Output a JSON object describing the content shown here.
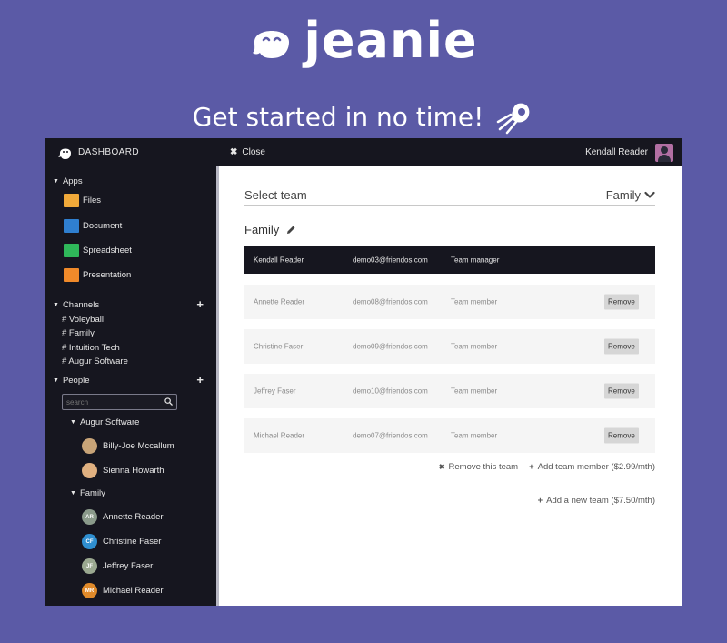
{
  "brand": {
    "name": "jeanie",
    "tagline": "Get started in no time!"
  },
  "topbar": {
    "dashboard_label": "DASHBOARD",
    "close_label": "Close",
    "user_name": "Kendall Reader"
  },
  "sidebar": {
    "apps_label": "Apps",
    "apps": [
      {
        "label": "Files",
        "color": "#f0a93a"
      },
      {
        "label": "Document",
        "color": "#2f7fd0"
      },
      {
        "label": "Spreadsheet",
        "color": "#2fb85a"
      },
      {
        "label": "Presentation",
        "color": "#f08a2a"
      }
    ],
    "channels_label": "Channels",
    "channels": [
      "# Voleyball",
      "# Family",
      "# Intuition Tech",
      "# Augur Software"
    ],
    "people_label": "People",
    "search_placeholder": "search",
    "groups": [
      {
        "name": "Augur Software",
        "people": [
          {
            "name": "Billy-Joe Mccallum",
            "initials": "",
            "color": "#c8a478"
          },
          {
            "name": "Sienna Howarth",
            "initials": "",
            "color": "#e0b080"
          }
        ]
      },
      {
        "name": "Family",
        "people": [
          {
            "name": "Annette Reader",
            "initials": "AR",
            "color": "#8a9a8a"
          },
          {
            "name": "Christine Faser",
            "initials": "CF",
            "color": "#2f8fd0"
          },
          {
            "name": "Jeffrey Faser",
            "initials": "JF",
            "color": "#9aa890"
          },
          {
            "name": "Michael Reader",
            "initials": "MR",
            "color": "#e08a2a"
          }
        ]
      }
    ]
  },
  "main": {
    "select_label": "Select team",
    "selected_team": "Family",
    "team_title": "Family",
    "header_row": {
      "name": "Kendall Reader",
      "email": "demo03@friendos.com",
      "role": "Team manager"
    },
    "rows": [
      {
        "name": "Annette Reader",
        "email": "demo08@friendos.com",
        "role": "Team member",
        "action": "Remove"
      },
      {
        "name": "Christine Faser",
        "email": "demo09@friendos.com",
        "role": "Team member",
        "action": "Remove"
      },
      {
        "name": "Jeffrey Faser",
        "email": "demo10@friendos.com",
        "role": "Team member",
        "action": "Remove"
      },
      {
        "name": "Michael Reader",
        "email": "demo07@friendos.com",
        "role": "Team member",
        "action": "Remove"
      }
    ],
    "remove_team_label": "Remove this team",
    "add_member_label": "Add team member ($2.99/mth)",
    "add_team_label": "Add a new team ($7.50/mth)"
  },
  "colors": {
    "background": "#5b5aa6",
    "dark": "#16161f",
    "accent": "#ffffff"
  }
}
